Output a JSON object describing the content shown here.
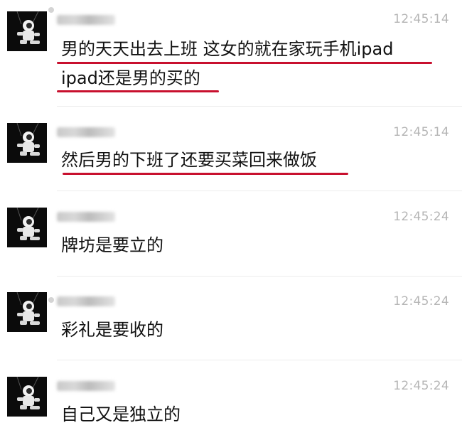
{
  "messages": [
    {
      "time": "12:45:14",
      "lines": [
        "男的天天出去上班 这女的就在家玩手机ipad",
        "ipad还是男的买的"
      ],
      "underlined": true
    },
    {
      "time": "12:45:14",
      "lines": [
        "然后男的下班了还要买菜回来做饭"
      ],
      "underlined": true
    },
    {
      "time": "12:45:24",
      "lines": [
        "牌坊是要立的"
      ],
      "underlined": false
    },
    {
      "time": "12:45:24",
      "lines": [
        "彩礼是要收的"
      ],
      "underlined": false
    },
    {
      "time": "12:45:24",
      "lines": [
        "自己又是独立的"
      ],
      "underlined": false
    }
  ],
  "colors": {
    "underline": "#c8102e",
    "time": "#b5b5b5",
    "text": "#111111"
  },
  "icons": {
    "avatar": "astronaut-avatar-icon"
  }
}
